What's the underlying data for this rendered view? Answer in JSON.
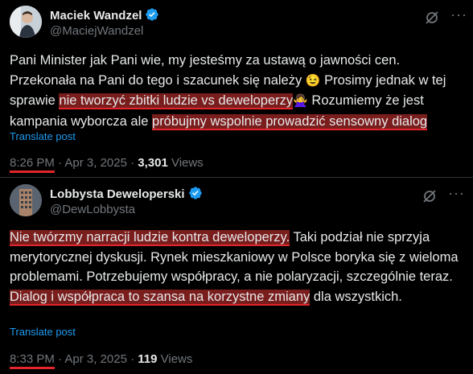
{
  "tweets": [
    {
      "author_name": "Maciek Wandzel",
      "handle": "@MaciejWandzel",
      "text_parts": {
        "p1": "Pani Minister jak Pani wie, my jesteśmy za ustawą o jawności cen. Przekonała na Pani do tego  i szacunek się należy ",
        "emoji1": "😉",
        "p2": " Prosimy jednak w tej sprawie ",
        "h1": "nie tworzyć zbitki ludzie vs deweloperzy",
        "emoji2": "🙅‍♀️",
        "p3": " Rozumiemy że jest kampania wyborcza ale ",
        "h2": "próbujmy wspolnie prowadzić sensowny dialog"
      },
      "translate_label": "Translate post",
      "time": "8:26 PM",
      "date": " · Apr 3, 2025 · ",
      "views_count": "3,301",
      "views_label": " Views"
    },
    {
      "author_name": "Lobbysta Deweloperski",
      "handle": "@DewLobbysta",
      "text_parts": {
        "h1": "Nie twórzmy narracji ludzie kontra deweloperzy.",
        "p1": " Taki podział nie sprzyja merytorycznej dyskusji. Rynek mieszkaniowy w Polsce boryka się z wieloma problemami. Potrzebujemy współpracy, a nie polaryzacji, szczególnie teraz. ",
        "h2": "Dialog i współpraca to szansa na korzystne zmiany",
        "p2": " dla wszystkich."
      },
      "translate_label": "Translate post",
      "time": "8:33 PM",
      "date": " · Apr 3, 2025 · ",
      "views_count": "119",
      "views_label": " Views"
    }
  ],
  "icons": {
    "verified": "verified-badge-icon",
    "grok": "grok-icon",
    "more": "more-icon"
  },
  "colors": {
    "background": "#000000",
    "text": "#e7e9ea",
    "muted": "#71767b",
    "link": "#1d9bf0",
    "verified": "#1d9bf0",
    "highlight_underline": "#e3262b"
  }
}
